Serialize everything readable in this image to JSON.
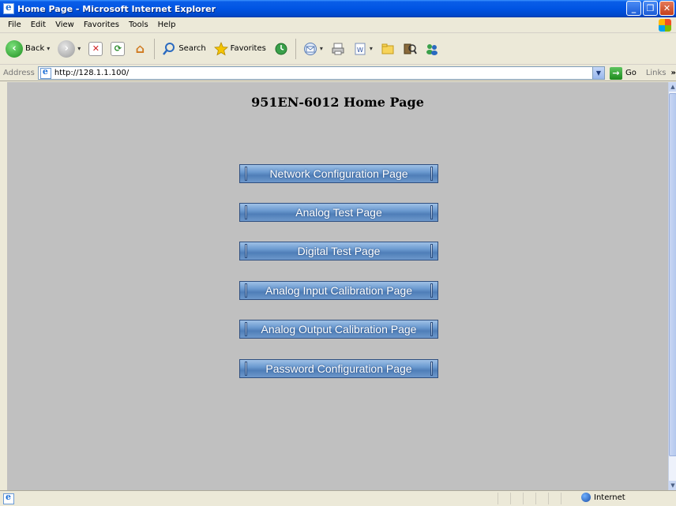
{
  "window": {
    "title": "Home Page - Microsoft Internet Explorer",
    "controls": [
      "minimize",
      "maximize",
      "close"
    ]
  },
  "menu": {
    "items": [
      "File",
      "Edit",
      "View",
      "Favorites",
      "Tools",
      "Help"
    ]
  },
  "toolbar": {
    "back_label": "Back",
    "search_label": "Search",
    "favorites_label": "Favorites"
  },
  "address_bar": {
    "label": "Address",
    "url": "http://128.1.1.100/",
    "go_label": "Go",
    "links_label": "Links"
  },
  "page": {
    "heading": "951EN-6012 Home Page",
    "buttons": [
      "Network Configuration Page",
      "Analog Test Page",
      "Digital Test Page",
      "Analog Input Calibration Page",
      "Analog Output Calibration Page",
      "Password Configuration Page"
    ]
  },
  "status_bar": {
    "zone": "Internet"
  }
}
